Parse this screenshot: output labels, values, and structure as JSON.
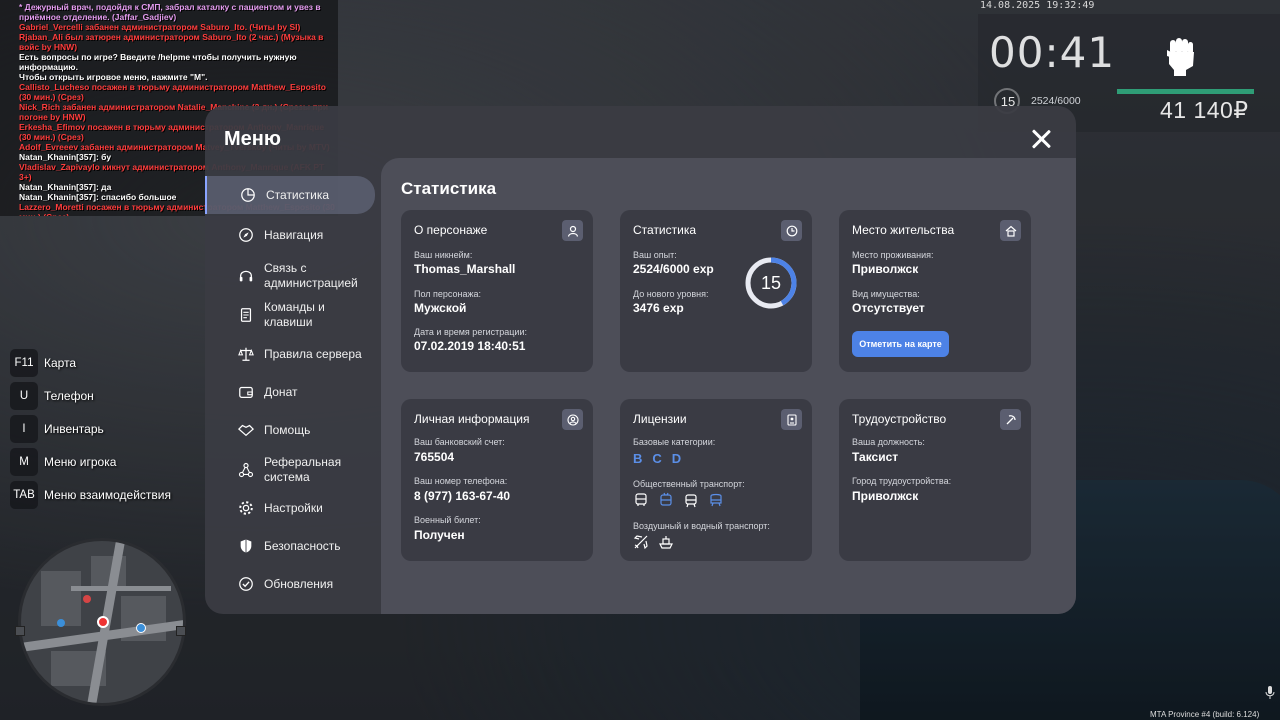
{
  "chat": [
    {
      "text": "* Дежурный врач, подойдя к СМП, забрал каталку с пациентом и увез в приёмное отделение. (Jaffar_Gadjiev)",
      "color": "#e59cf0"
    },
    {
      "text": "Gabriel_Vercelli забанен администратором Saburo_Ito. (Читы by SI)",
      "color": "#ff3d3d"
    },
    {
      "text": "Rjaban_Ali был затюрен администратором Saburo_Ito (2 час.) (Музыка в войс by HNW)",
      "color": "#ff3d3d"
    },
    {
      "text": "Есть вопросы по игре? Введите /helpme чтобы получить нужную информацию.",
      "color": "#ffffff"
    },
    {
      "text": "Чтобы открыть игровое меню, нажмите \"M\".",
      "color": "#ffffff"
    },
    {
      "text": "Callisto_Lucheso посажен в тюрьму администратором Matthew_Esposito (30 мин.) (Срез)",
      "color": "#ff3d3d"
    },
    {
      "text": "Nick_Rich забанен администратором Natalie_Manchine (3 дн.) (Срезы при погоне by HNW)",
      "color": "#ff3d3d"
    },
    {
      "text": "Erkesha_Efimov посажен в тюрьму администратором Anthony_Manrique (30 мин.) (Срез)",
      "color": "#ff3d3d"
    },
    {
      "text": "Adolf_Evreeev забанен администратором Matvey_Tverskoy (Читы by MTV)",
      "color": "#ff3d3d"
    },
    {
      "text": "Natan_Khanin[357]: бу",
      "color": "#ffffff"
    },
    {
      "text": "Vladislav_Zapivaylo кикнут администратором Anthony_Manrique (AFK PT 3+)",
      "color": "#ff3d3d"
    },
    {
      "text": "Natan_Khanin[357]: да",
      "color": "#ffffff"
    },
    {
      "text": "Natan_Khanin[357]: спасибо большое",
      "color": "#ffffff"
    },
    {
      "text": "Lazzero_Moretti посажен в тюрьму администратором Matthew_Esposito (30 мин.) (Срез)",
      "color": "#ff3d3d"
    }
  ],
  "hud": {
    "datetime": "14.08.2025 19:32:49",
    "timer": "00:41",
    "level": "15",
    "exp": "2524/6000",
    "money": "41 140₽",
    "health_fraction": 1.0
  },
  "hotkeys": [
    {
      "key": "F11",
      "label": "Карта"
    },
    {
      "key": "U",
      "label": "Телефон"
    },
    {
      "key": "I",
      "label": "Инвентарь"
    },
    {
      "key": "M",
      "label": "Меню игрока"
    },
    {
      "key": "TAB",
      "label": "Меню взаимодействия"
    }
  ],
  "menu": {
    "title": "Меню",
    "nav": [
      {
        "label": "Статистика",
        "icon": "pie-chart-icon",
        "active": true
      },
      {
        "label": "Навигация",
        "icon": "compass-icon"
      },
      {
        "label": "Связь с администрацией",
        "icon": "headset-icon"
      },
      {
        "label": "Команды и клавиши",
        "icon": "document-icon"
      },
      {
        "label": "Правила сервера",
        "icon": "scales-icon"
      },
      {
        "label": "Донат",
        "icon": "wallet-icon"
      },
      {
        "label": "Помощь",
        "icon": "handshake-icon"
      },
      {
        "label": "Реферальная система",
        "icon": "network-icon"
      },
      {
        "label": "Настройки",
        "icon": "gear-icon"
      },
      {
        "label": "Безопасность",
        "icon": "shield-icon"
      },
      {
        "label": "Обновления",
        "icon": "check-circle-icon"
      }
    ],
    "content_title": "Статистика",
    "cards": {
      "character": {
        "title": "О персонаже",
        "nick_label": "Ваш никнейм:",
        "nick": "Thomas_Marshall",
        "gender_label": "Пол персонажа:",
        "gender": "Мужской",
        "reg_label": "Дата и время регистрации:",
        "reg": "07.02.2019 18:40:51"
      },
      "stats": {
        "title": "Статистика",
        "exp_label": "Ваш опыт:",
        "exp": "2524/6000 exp",
        "next_label": "До нового уровня:",
        "next": "3476 exp",
        "level": "15",
        "progress": 0.42
      },
      "residence": {
        "title": "Место жительства",
        "place_label": "Место проживания:",
        "place": "Приволжск",
        "property_label": "Вид имущества:",
        "property": "Отсутствует",
        "button": "Отметить на карте"
      },
      "personal": {
        "title": "Личная информация",
        "bank_label": "Ваш банковский счет:",
        "bank": "765504",
        "phone_label": "Ваш номер телефона:",
        "phone": "8 (977) 163-67-40",
        "military_label": "Военный билет:",
        "military": "Получен"
      },
      "licenses": {
        "title": "Лицензии",
        "base_label": "Базовые категории:",
        "categories": [
          "B",
          "C",
          "D"
        ],
        "public_label": "Общественный транспорт:",
        "air_label": "Воздушный и водный транспорт:"
      },
      "employment": {
        "title": "Трудоустройство",
        "position_label": "Ваша должность:",
        "position": "Таксист",
        "city_label": "Город трудоустройства:",
        "city": "Приволжск"
      }
    }
  },
  "watermark": "MTA Province #4 (build: 6.124)",
  "colors": {
    "accent": "#4d82e6",
    "panel": "#3a3b44",
    "content_bg": "#4d4e58",
    "health": "#2f9d76",
    "chat_admin": "#ff3d3d"
  }
}
